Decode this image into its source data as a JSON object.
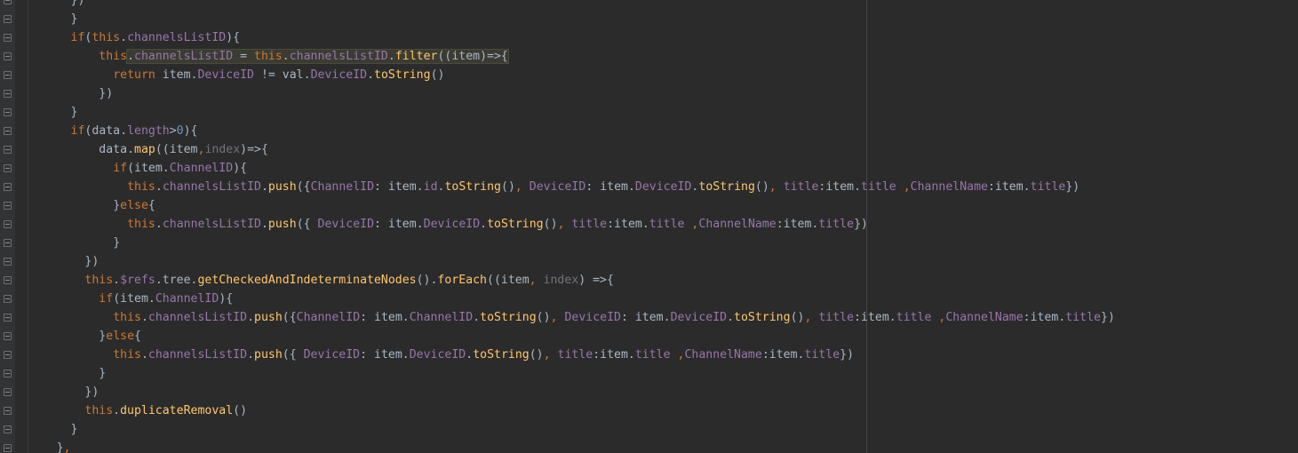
{
  "editor": {
    "colors": {
      "background": "#2b2b2b",
      "keyword": "#cc7832",
      "property": "#9876aa",
      "function": "#ffc66d",
      "number": "#6897bb",
      "unused_param": "#72737a",
      "text": "#a9b7c6",
      "highlight": "#3b3b33"
    },
    "fold_markers": [
      "fold-icon"
    ],
    "highlight_line": 3,
    "lines": [
      {
        "indent": 10,
        "tokens": [
          [
            "punc",
            "})"
          ]
        ]
      },
      {
        "indent": 10,
        "tokens": [
          [
            "punc",
            "}"
          ]
        ]
      },
      {
        "indent": 10,
        "tokens": [
          [
            "kw",
            "if"
          ],
          [
            "punc",
            "("
          ],
          [
            "this",
            "this"
          ],
          [
            "punc",
            "."
          ],
          [
            "prop",
            "channelsListID"
          ],
          [
            "punc",
            "){"
          ]
        ]
      },
      {
        "indent": 14,
        "tokens": [
          [
            "this",
            "this"
          ],
          [
            "punc",
            "."
          ],
          [
            "prop",
            "channelsListID"
          ],
          [
            "punc",
            " = "
          ],
          [
            "this",
            "this"
          ],
          [
            "punc",
            "."
          ],
          [
            "prop",
            "channelsListID"
          ],
          [
            "punc",
            "."
          ],
          [
            "fn",
            "filter"
          ],
          [
            "punc",
            "((item)=>{"
          ]
        ]
      },
      {
        "indent": 16,
        "tokens": [
          [
            "kw",
            "return "
          ],
          [
            "ident",
            "item"
          ],
          [
            "punc",
            "."
          ],
          [
            "prop",
            "DeviceID"
          ],
          [
            "punc",
            " != "
          ],
          [
            "ident",
            "val"
          ],
          [
            "punc",
            "."
          ],
          [
            "prop",
            "DeviceID"
          ],
          [
            "punc",
            "."
          ],
          [
            "fn",
            "toString"
          ],
          [
            "punc",
            "()"
          ]
        ]
      },
      {
        "indent": 14,
        "tokens": [
          [
            "punc",
            "})"
          ]
        ]
      },
      {
        "indent": 10,
        "tokens": [
          [
            "punc",
            "}"
          ]
        ]
      },
      {
        "indent": 10,
        "tokens": [
          [
            "kw",
            "if"
          ],
          [
            "punc",
            "("
          ],
          [
            "ident",
            "data"
          ],
          [
            "punc",
            "."
          ],
          [
            "prop",
            "length"
          ],
          [
            "punc",
            ">"
          ],
          [
            "num",
            "0"
          ],
          [
            "punc",
            "){"
          ]
        ]
      },
      {
        "indent": 14,
        "tokens": [
          [
            "ident",
            "data"
          ],
          [
            "punc",
            "."
          ],
          [
            "fn",
            "map"
          ],
          [
            "punc",
            "((item"
          ],
          [
            "comma",
            ","
          ],
          [
            "param",
            "index"
          ],
          [
            "punc",
            ")=>{"
          ]
        ]
      },
      {
        "indent": 16,
        "tokens": [
          [
            "kw",
            "if"
          ],
          [
            "punc",
            "("
          ],
          [
            "ident",
            "item"
          ],
          [
            "punc",
            "."
          ],
          [
            "prop",
            "ChannelID"
          ],
          [
            "punc",
            "){"
          ]
        ]
      },
      {
        "indent": 18,
        "tokens": [
          [
            "this",
            "this"
          ],
          [
            "punc",
            "."
          ],
          [
            "prop",
            "channelsListID"
          ],
          [
            "punc",
            "."
          ],
          [
            "fn",
            "push"
          ],
          [
            "punc",
            "({"
          ],
          [
            "prop",
            "ChannelID"
          ],
          [
            "punc",
            ": item."
          ],
          [
            "prop",
            "id"
          ],
          [
            "punc",
            "."
          ],
          [
            "fn",
            "toString"
          ],
          [
            "punc",
            "()"
          ],
          [
            "comma",
            ", "
          ],
          [
            "prop",
            "DeviceID"
          ],
          [
            "punc",
            ": item."
          ],
          [
            "prop",
            "DeviceID"
          ],
          [
            "punc",
            "."
          ],
          [
            "fn",
            "toString"
          ],
          [
            "punc",
            "()"
          ],
          [
            "comma",
            ", "
          ],
          [
            "prop",
            "title"
          ],
          [
            "punc",
            ":item."
          ],
          [
            "prop",
            "title"
          ],
          [
            "punc",
            " "
          ],
          [
            "comma",
            ","
          ],
          [
            "prop",
            "ChannelName"
          ],
          [
            "punc",
            ":item."
          ],
          [
            "prop",
            "title"
          ],
          [
            "punc",
            "})"
          ]
        ]
      },
      {
        "indent": 16,
        "tokens": [
          [
            "punc",
            "}"
          ],
          [
            "kw",
            "else"
          ],
          [
            "punc",
            "{"
          ]
        ]
      },
      {
        "indent": 18,
        "tokens": [
          [
            "this",
            "this"
          ],
          [
            "punc",
            "."
          ],
          [
            "prop",
            "channelsListID"
          ],
          [
            "punc",
            "."
          ],
          [
            "fn",
            "push"
          ],
          [
            "punc",
            "({ "
          ],
          [
            "prop",
            "DeviceID"
          ],
          [
            "punc",
            ": item."
          ],
          [
            "prop",
            "DeviceID"
          ],
          [
            "punc",
            "."
          ],
          [
            "fn",
            "toString"
          ],
          [
            "punc",
            "()"
          ],
          [
            "comma",
            ", "
          ],
          [
            "prop",
            "title"
          ],
          [
            "punc",
            ":item."
          ],
          [
            "prop",
            "title"
          ],
          [
            "punc",
            " "
          ],
          [
            "comma",
            ","
          ],
          [
            "prop",
            "ChannelName"
          ],
          [
            "punc",
            ":item."
          ],
          [
            "prop",
            "title"
          ],
          [
            "punc",
            "})"
          ]
        ]
      },
      {
        "indent": 16,
        "tokens": [
          [
            "punc",
            "}"
          ]
        ]
      },
      {
        "indent": 12,
        "tokens": [
          [
            "punc",
            "})"
          ]
        ]
      },
      {
        "indent": 12,
        "tokens": [
          [
            "this",
            "this"
          ],
          [
            "punc",
            "."
          ],
          [
            "prop",
            "$refs"
          ],
          [
            "punc",
            ".tree."
          ],
          [
            "fn",
            "getCheckedAndIndeterminateNodes"
          ],
          [
            "punc",
            "()."
          ],
          [
            "fn",
            "forEach"
          ],
          [
            "punc",
            "((item"
          ],
          [
            "comma",
            ", "
          ],
          [
            "param",
            "index"
          ],
          [
            "punc",
            ") =>{"
          ]
        ]
      },
      {
        "indent": 14,
        "tokens": [
          [
            "kw",
            "if"
          ],
          [
            "punc",
            "("
          ],
          [
            "ident",
            "item"
          ],
          [
            "punc",
            "."
          ],
          [
            "prop",
            "ChannelID"
          ],
          [
            "punc",
            "){"
          ]
        ]
      },
      {
        "indent": 16,
        "tokens": [
          [
            "this",
            "this"
          ],
          [
            "punc",
            "."
          ],
          [
            "prop",
            "channelsListID"
          ],
          [
            "punc",
            "."
          ],
          [
            "fn",
            "push"
          ],
          [
            "punc",
            "({"
          ],
          [
            "prop",
            "ChannelID"
          ],
          [
            "punc",
            ": item."
          ],
          [
            "prop",
            "ChannelID"
          ],
          [
            "punc",
            "."
          ],
          [
            "fn",
            "toString"
          ],
          [
            "punc",
            "()"
          ],
          [
            "comma",
            ", "
          ],
          [
            "prop",
            "DeviceID"
          ],
          [
            "punc",
            ": item."
          ],
          [
            "prop",
            "DeviceID"
          ],
          [
            "punc",
            "."
          ],
          [
            "fn",
            "toString"
          ],
          [
            "punc",
            "()"
          ],
          [
            "comma",
            ", "
          ],
          [
            "prop",
            "title"
          ],
          [
            "punc",
            ":item."
          ],
          [
            "prop",
            "title"
          ],
          [
            "punc",
            " "
          ],
          [
            "comma",
            ","
          ],
          [
            "prop",
            "ChannelName"
          ],
          [
            "punc",
            ":item."
          ],
          [
            "prop",
            "title"
          ],
          [
            "punc",
            "})"
          ]
        ]
      },
      {
        "indent": 14,
        "tokens": [
          [
            "punc",
            "}"
          ],
          [
            "kw",
            "else"
          ],
          [
            "punc",
            "{"
          ]
        ]
      },
      {
        "indent": 16,
        "tokens": [
          [
            "this",
            "this"
          ],
          [
            "punc",
            "."
          ],
          [
            "prop",
            "channelsListID"
          ],
          [
            "punc",
            "."
          ],
          [
            "fn",
            "push"
          ],
          [
            "punc",
            "({ "
          ],
          [
            "prop",
            "DeviceID"
          ],
          [
            "punc",
            ": item."
          ],
          [
            "prop",
            "DeviceID"
          ],
          [
            "punc",
            "."
          ],
          [
            "fn",
            "toString"
          ],
          [
            "punc",
            "()"
          ],
          [
            "comma",
            ", "
          ],
          [
            "prop",
            "title"
          ],
          [
            "punc",
            ":item."
          ],
          [
            "prop",
            "title"
          ],
          [
            "punc",
            " "
          ],
          [
            "comma",
            ","
          ],
          [
            "prop",
            "ChannelName"
          ],
          [
            "punc",
            ":item."
          ],
          [
            "prop",
            "title"
          ],
          [
            "punc",
            "})"
          ]
        ]
      },
      {
        "indent": 14,
        "tokens": [
          [
            "punc",
            "}"
          ]
        ]
      },
      {
        "indent": 12,
        "tokens": [
          [
            "punc",
            "})"
          ]
        ]
      },
      {
        "indent": 12,
        "tokens": [
          [
            "this",
            "this"
          ],
          [
            "punc",
            "."
          ],
          [
            "fn",
            "duplicateRemoval"
          ],
          [
            "punc",
            "()"
          ]
        ]
      },
      {
        "indent": 10,
        "tokens": [
          [
            "punc",
            "}"
          ]
        ]
      },
      {
        "indent": 8,
        "tokens": [
          [
            "punc",
            "}"
          ],
          [
            "comma",
            ","
          ]
        ]
      }
    ]
  }
}
